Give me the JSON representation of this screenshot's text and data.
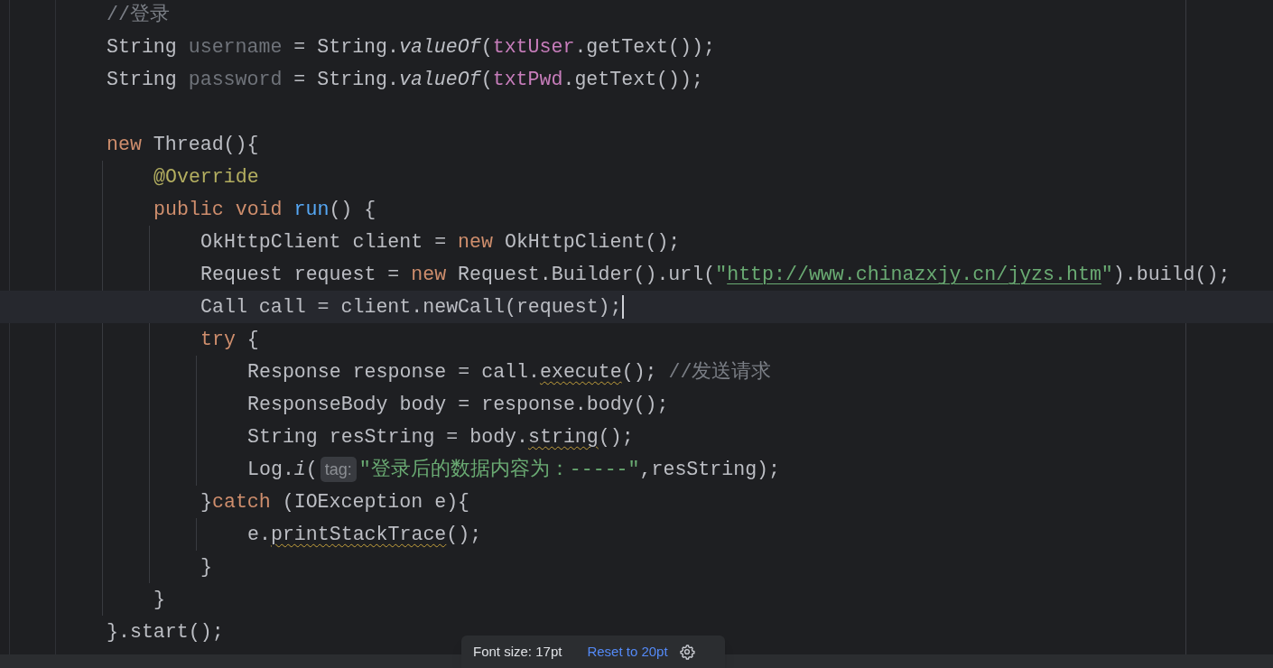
{
  "editor": {
    "lines": [
      {
        "current": false,
        "tokens": [
          {
            "text": "//登录",
            "kind": "comment"
          }
        ]
      },
      {
        "current": false,
        "tokens": [
          {
            "text": "String ",
            "kind": "plain"
          },
          {
            "text": "username",
            "kind": "unused"
          },
          {
            "text": " = String.",
            "kind": "plain"
          },
          {
            "text": "valueOf",
            "kind": "static"
          },
          {
            "text": "(",
            "kind": "plain"
          },
          {
            "text": "txtUser",
            "kind": "field"
          },
          {
            "text": ".getText());",
            "kind": "plain"
          }
        ]
      },
      {
        "current": false,
        "tokens": [
          {
            "text": "String ",
            "kind": "plain"
          },
          {
            "text": "password",
            "kind": "unused"
          },
          {
            "text": " = String.",
            "kind": "plain"
          },
          {
            "text": "valueOf",
            "kind": "static"
          },
          {
            "text": "(",
            "kind": "plain"
          },
          {
            "text": "txtPwd",
            "kind": "field"
          },
          {
            "text": ".getText());",
            "kind": "plain"
          }
        ]
      },
      {
        "current": false
      },
      {
        "current": false,
        "tokens": [
          {
            "text": "new ",
            "kind": "keyword"
          },
          {
            "text": "Thread(){",
            "kind": "plain"
          }
        ],
        "children": [
          {
            "current": false,
            "tokens": [
              {
                "text": "@Override",
                "kind": "annotation"
              }
            ]
          },
          {
            "current": false,
            "tokens": [
              {
                "text": "public void ",
                "kind": "keyword"
              },
              {
                "text": "run",
                "kind": "decl"
              },
              {
                "text": "() {",
                "kind": "plain"
              }
            ],
            "children": [
              {
                "current": false,
                "tokens": [
                  {
                    "text": "OkHttpClient client = ",
                    "kind": "plain"
                  },
                  {
                    "text": "new ",
                    "kind": "keyword"
                  },
                  {
                    "text": "OkHttpClient();",
                    "kind": "plain"
                  }
                ]
              },
              {
                "current": false,
                "tokens": [
                  {
                    "text": "Request request = ",
                    "kind": "plain"
                  },
                  {
                    "text": "new ",
                    "kind": "keyword"
                  },
                  {
                    "text": "Request.Builder().url(",
                    "kind": "plain"
                  },
                  {
                    "text": "\"",
                    "kind": "string"
                  },
                  {
                    "text": "http://www.chinazxjy.cn/jyzs.htm",
                    "kind": "url"
                  },
                  {
                    "text": "\"",
                    "kind": "string"
                  },
                  {
                    "text": ").build();",
                    "kind": "plain"
                  }
                ]
              },
              {
                "current": true,
                "tokens": [
                  {
                    "text": "Call call = client.newCall(request);",
                    "kind": "plain"
                  }
                ]
              },
              {
                "current": false,
                "tokens": [
                  {
                    "text": "try ",
                    "kind": "keyword"
                  },
                  {
                    "text": "{",
                    "kind": "plain"
                  }
                ],
                "children": [
                  {
                    "current": false,
                    "tokens": [
                      {
                        "text": "Response response = call.",
                        "kind": "plain"
                      },
                      {
                        "text": "execute",
                        "kind": "warn"
                      },
                      {
                        "text": "(); ",
                        "kind": "plain"
                      },
                      {
                        "text": "//发送请求",
                        "kind": "comment"
                      }
                    ]
                  },
                  {
                    "current": false,
                    "tokens": [
                      {
                        "text": "ResponseBody body = response.body();",
                        "kind": "plain"
                      }
                    ]
                  },
                  {
                    "current": false,
                    "tokens": [
                      {
                        "text": "String resString = body.",
                        "kind": "plain"
                      },
                      {
                        "text": "string",
                        "kind": "warn"
                      },
                      {
                        "text": "();",
                        "kind": "plain"
                      }
                    ]
                  },
                  {
                    "current": false,
                    "tokens": [
                      {
                        "text": "Log.",
                        "kind": "plain"
                      },
                      {
                        "text": "i",
                        "kind": "static"
                      },
                      {
                        "text": "(",
                        "kind": "plain"
                      },
                      {
                        "text": "tag:",
                        "kind": "hint"
                      },
                      {
                        "text": "\"登录后的数据内容为：-----\"",
                        "kind": "string"
                      },
                      {
                        "text": ",resString);",
                        "kind": "plain"
                      }
                    ]
                  }
                ]
              },
              {
                "current": false,
                "tokens": [
                  {
                    "text": "}",
                    "kind": "plain"
                  },
                  {
                    "text": "catch ",
                    "kind": "keyword"
                  },
                  {
                    "text": "(IOException e){",
                    "kind": "plain"
                  }
                ],
                "children": [
                  {
                    "current": false,
                    "tokens": [
                      {
                        "text": "e.",
                        "kind": "plain"
                      },
                      {
                        "text": "printStackTrace",
                        "kind": "warn"
                      },
                      {
                        "text": "();",
                        "kind": "plain"
                      }
                    ]
                  }
                ]
              },
              {
                "current": false,
                "tokens": [
                  {
                    "text": "}",
                    "kind": "plain"
                  }
                ]
              }
            ]
          },
          {
            "current": false,
            "tokens": [
              {
                "text": "}",
                "kind": "plain"
              }
            ]
          }
        ]
      },
      {
        "current": false,
        "tokens": [
          {
            "text": "}.start();",
            "kind": "plain"
          }
        ]
      }
    ]
  },
  "popup": {
    "label": "Font size: 17pt",
    "link": "Reset to 20pt"
  }
}
